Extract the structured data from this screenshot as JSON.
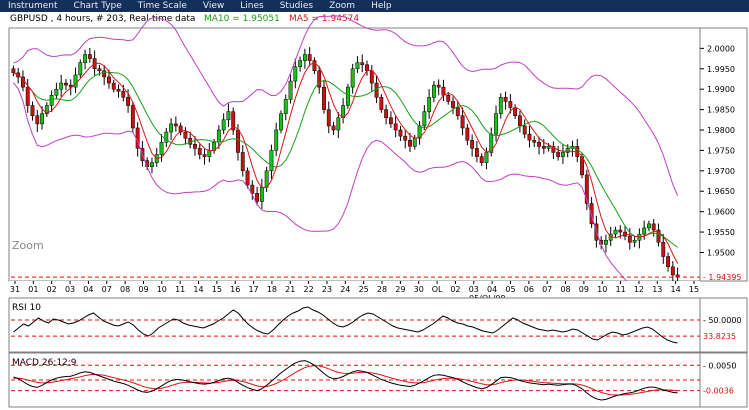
{
  "menu": {
    "items": [
      "Instrument",
      "Chart Type",
      "Time Scale",
      "View",
      "Lines",
      "Studies",
      "Zoom",
      "Help"
    ]
  },
  "colors": {
    "menubar": "#132f5c",
    "panel_bg": "#ffffff",
    "bull_candle": "#19c019",
    "bear_candle": "#c81212",
    "ma10": "#16a016",
    "ma5": "#d81818",
    "bollinger": "#c040c0",
    "price_marker": "#e01010",
    "indicator_line": "#000000"
  },
  "chart_data": [
    {
      "type": "candlestick",
      "title_parts": {
        "symbol_info": "GBPUSD , 4 hours, # 203, Real-time data",
        "ma10_label": "MA10 = 1.95051",
        "ma5_label": "MA5 = 1.94574"
      },
      "zoom_label": "Zoom",
      "yaxis_ticks": [
        "2.0000",
        "1.9950",
        "1.9900",
        "1.9850",
        "1.9800",
        "1.9750",
        "1.9700",
        "1.9650",
        "1.9600",
        "1.9550",
        "1.9500"
      ],
      "ylim": [
        1.9435,
        2.0045
      ],
      "last_price": "1.94395",
      "x_tick_labels": [
        "31",
        "01",
        "02",
        "03",
        "04",
        "07",
        "08",
        "09",
        "10",
        "11",
        "14",
        "15",
        "16",
        "17",
        "18",
        "21",
        "22",
        "23",
        "24",
        "25",
        "28",
        "29",
        "30",
        "OL",
        "02",
        "03",
        "04",
        "05",
        "06",
        "07",
        "08",
        "09",
        "10",
        "11",
        "12",
        "13",
        "14",
        "15"
      ],
      "date_label": "05/OL/08",
      "close_series": [
        1.994,
        1.993,
        1.9905,
        1.986,
        1.9835,
        1.9815,
        1.984,
        1.986,
        1.9885,
        1.99,
        1.9915,
        1.991,
        1.9905,
        1.9935,
        1.9965,
        1.9985,
        1.9975,
        1.995,
        1.9945,
        1.993,
        1.9915,
        1.99,
        1.9895,
        1.988,
        1.986,
        1.9805,
        1.9755,
        1.9725,
        1.971,
        1.972,
        1.974,
        1.977,
        1.9795,
        1.9815,
        1.981,
        1.9795,
        1.978,
        1.9765,
        1.9755,
        1.974,
        1.9735,
        1.975,
        1.977,
        1.98,
        1.9825,
        1.9845,
        1.98,
        1.9745,
        1.97,
        1.9665,
        1.9645,
        1.9625,
        1.966,
        1.97,
        1.975,
        1.98,
        1.984,
        1.9875,
        1.992,
        1.9955,
        1.997,
        1.9985,
        1.997,
        1.9945,
        1.9905,
        1.985,
        1.981,
        1.98,
        1.983,
        1.986,
        1.9905,
        1.995,
        1.9965,
        1.996,
        1.9945,
        1.9915,
        1.988,
        1.985,
        1.983,
        1.9815,
        1.98,
        1.9785,
        1.9775,
        1.976,
        1.978,
        1.981,
        1.9845,
        1.988,
        1.991,
        1.9905,
        1.9885,
        1.987,
        1.9855,
        1.9835,
        1.9805,
        1.9775,
        1.9755,
        1.9735,
        1.972,
        1.9745,
        1.979,
        1.984,
        1.988,
        1.987,
        1.9855,
        1.9835,
        1.981,
        1.979,
        1.9775,
        1.977,
        1.976,
        1.9755,
        1.976,
        1.9745,
        1.9735,
        1.9745,
        1.9755,
        1.976,
        1.9735,
        1.969,
        1.962,
        1.957,
        1.953,
        1.952,
        1.953,
        1.9545,
        1.9555,
        1.955,
        1.954,
        1.9525,
        1.953,
        1.9545,
        1.956,
        1.957,
        1.9555,
        1.9525,
        1.949,
        1.9465,
        1.9445,
        1.944
      ]
    },
    {
      "type": "line",
      "name": "RSI 10",
      "ylim": [
        20,
        70
      ],
      "yaxis_values": [
        "50.0000",
        "33.8235"
      ],
      "ref_lines": [
        50,
        33.8235
      ],
      "values": [
        38,
        42,
        46,
        44,
        48,
        52,
        49,
        47,
        51,
        50,
        48,
        46,
        47,
        49,
        52,
        55,
        57,
        53,
        49,
        47,
        45,
        44,
        46,
        48,
        45,
        40,
        36,
        34,
        37,
        42,
        45,
        48,
        51,
        50,
        47,
        45,
        44,
        43,
        42,
        44,
        46,
        49,
        52,
        56,
        60,
        57,
        51,
        46,
        42,
        39,
        37,
        36,
        40,
        45,
        50,
        54,
        57,
        59,
        62,
        63,
        60,
        58,
        55,
        51,
        47,
        44,
        43,
        45,
        48,
        52,
        55,
        57,
        56,
        53,
        50,
        47,
        44,
        42,
        41,
        40,
        39,
        38,
        40,
        43,
        46,
        50,
        54,
        52,
        49,
        47,
        46,
        44,
        43,
        41,
        39,
        38,
        37,
        40,
        44,
        48,
        52,
        50,
        47,
        45,
        43,
        41,
        40,
        39,
        40,
        39,
        38,
        39,
        41,
        40,
        37,
        34,
        31,
        30,
        33,
        36,
        38,
        37,
        35,
        36,
        38,
        40,
        42,
        43,
        41,
        37,
        33,
        30,
        28,
        27
      ]
    },
    {
      "type": "line",
      "name": "MACD 26;12;9",
      "ylim": [
        -0.0085,
        0.0085
      ],
      "yaxis_values": [
        "0.0050",
        "-0.0036"
      ],
      "ref_lines": [
        0.005,
        0,
        -0.0036
      ],
      "macd": [
        0.001,
        0.0005,
        -0.0005,
        -0.0015,
        -0.0022,
        -0.0025,
        -0.0018,
        -0.0008,
        0.0,
        0.0006,
        0.001,
        0.0012,
        0.0013,
        0.0018,
        0.0024,
        0.0028,
        0.0026,
        0.002,
        0.0014,
        0.0008,
        0.0002,
        -0.0004,
        -0.0008,
        -0.0012,
        -0.0018,
        -0.0026,
        -0.0034,
        -0.004,
        -0.0042,
        -0.0038,
        -0.003,
        -0.002,
        -0.001,
        -0.0002,
        0.0002,
        0.0001,
        -0.0002,
        -0.0006,
        -0.001,
        -0.0013,
        -0.0014,
        -0.0012,
        -0.0008,
        -0.0002,
        0.0004,
        0.0006,
        0.0002,
        -0.0008,
        -0.0018,
        -0.0026,
        -0.0032,
        -0.0036,
        -0.003,
        -0.0018,
        -0.0004,
        0.001,
        0.0024,
        0.0036,
        0.0048,
        0.0058,
        0.0064,
        0.0066,
        0.006,
        0.005,
        0.0036,
        0.0022,
        0.001,
        0.0004,
        0.0006,
        0.0012,
        0.002,
        0.0028,
        0.0032,
        0.003,
        0.0026,
        0.0018,
        0.001,
        0.0002,
        -0.0004,
        -0.001,
        -0.0014,
        -0.0018,
        -0.002,
        -0.0022,
        -0.0018,
        -0.001,
        -0.0002,
        0.0008,
        0.0016,
        0.0018,
        0.0016,
        0.0012,
        0.0008,
        0.0002,
        -0.0006,
        -0.0014,
        -0.002,
        -0.0026,
        -0.003,
        -0.0026,
        -0.0016,
        -0.0004,
        0.0008,
        0.001,
        0.0008,
        0.0004,
        -0.0002,
        -0.0006,
        -0.001,
        -0.0012,
        -0.0014,
        -0.0016,
        -0.0014,
        -0.0016,
        -0.0018,
        -0.0016,
        -0.0014,
        -0.0014,
        -0.002,
        -0.003,
        -0.0044,
        -0.0056,
        -0.0064,
        -0.0068,
        -0.0066,
        -0.006,
        -0.0054,
        -0.005,
        -0.0046,
        -0.0044,
        -0.004,
        -0.0034,
        -0.0028,
        -0.0024,
        -0.0024,
        -0.0028,
        -0.0034,
        -0.0038,
        -0.0042,
        -0.0044
      ],
      "signal": [
        0.0006,
        0.0006,
        0.0004,
        0.0,
        -0.0004,
        -0.0008,
        -0.001,
        -0.001,
        -0.0008,
        -0.0005,
        -0.0002,
        0.0001,
        0.0004,
        0.0007,
        0.0011,
        0.0015,
        0.0018,
        0.0019,
        0.0018,
        0.0016,
        0.0012,
        0.0008,
        0.0004,
        0.0,
        -0.0004,
        -0.0009,
        -0.0015,
        -0.0021,
        -0.0026,
        -0.0029,
        -0.003,
        -0.0028,
        -0.0024,
        -0.0019,
        -0.0014,
        -0.001,
        -0.0008,
        -0.0008,
        -0.0008,
        -0.0009,
        -0.001,
        -0.0011,
        -0.001,
        -0.0008,
        -0.0005,
        -0.0002,
        -0.0001,
        -0.0002,
        -0.0005,
        -0.001,
        -0.0015,
        -0.002,
        -0.0023,
        -0.0022,
        -0.0018,
        -0.0012,
        -0.0004,
        0.0005,
        0.0015,
        0.0025,
        0.0034,
        0.0042,
        0.0047,
        0.0049,
        0.0048,
        0.0044,
        0.0038,
        0.0031,
        0.0026,
        0.0023,
        0.0022,
        0.0023,
        0.0025,
        0.0026,
        0.0026,
        0.0024,
        0.0021,
        0.0017,
        0.0012,
        0.0007,
        0.0003,
        -0.0001,
        -0.0005,
        -0.0008,
        -0.001,
        -0.001,
        -0.0009,
        -0.0005,
        -0.0001,
        0.0002,
        0.0005,
        0.0006,
        0.0006,
        0.0005,
        0.0002,
        -0.0001,
        -0.0005,
        -0.0009,
        -0.0013,
        -0.0016,
        -0.0016,
        -0.0014,
        -0.0009,
        -0.0005,
        -0.0002,
        0.0,
        0.0,
        -0.0001,
        -0.0003,
        -0.0005,
        -0.0007,
        -0.0009,
        -0.001,
        -0.0011,
        -0.0012,
        -0.0013,
        -0.0013,
        -0.0013,
        -0.0014,
        -0.0017,
        -0.0022,
        -0.0029,
        -0.0036,
        -0.0042,
        -0.0047,
        -0.005,
        -0.0051,
        -0.0051,
        -0.005,
        -0.0049,
        -0.0047,
        -0.0044,
        -0.0041,
        -0.0038,
        -0.0035,
        -0.0033,
        -0.0033,
        -0.0034,
        -0.0035,
        -0.0037
      ]
    }
  ]
}
